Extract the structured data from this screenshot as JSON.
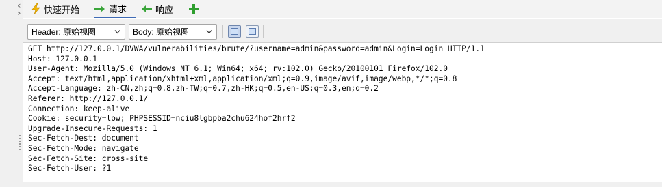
{
  "tabs": [
    {
      "label": "快速开始",
      "icon": "lightning-icon",
      "color": "#f0b400"
    },
    {
      "label": "请求",
      "icon": "arrow-right-icon",
      "color": "#3aa53a"
    },
    {
      "label": "响应",
      "icon": "arrow-left-icon",
      "color": "#3aa53a"
    }
  ],
  "add_tab_icon": "plus-icon",
  "toolbar": {
    "header_select": {
      "value": "Header: 原始视图"
    },
    "body_select": {
      "value": "Body: 原始视图"
    },
    "view_buttons": [
      "split-horizontal-icon",
      "single-pane-icon"
    ]
  },
  "request_lines": [
    "GET http://127.0.0.1/DVWA/vulnerabilities/brute/?username=admin&password=admin&Login=Login HTTP/1.1",
    "Host: 127.0.0.1",
    "User-Agent: Mozilla/5.0 (Windows NT 6.1; Win64; x64; rv:102.0) Gecko/20100101 Firefox/102.0",
    "Accept: text/html,application/xhtml+xml,application/xml;q=0.9,image/avif,image/webp,*/*;q=0.8",
    "Accept-Language: zh-CN,zh;q=0.8,zh-TW;q=0.7,zh-HK;q=0.5,en-US;q=0.3,en;q=0.2",
    "Referer: http://127.0.0.1/",
    "Connection: keep-alive",
    "Cookie: security=low; PHPSESSID=nciu8lgbpba2chu624hof2hrf2",
    "Upgrade-Insecure-Requests: 1",
    "Sec-Fetch-Dest: document",
    "Sec-Fetch-Mode: navigate",
    "Sec-Fetch-Site: cross-site",
    "Sec-Fetch-User: ?1"
  ]
}
